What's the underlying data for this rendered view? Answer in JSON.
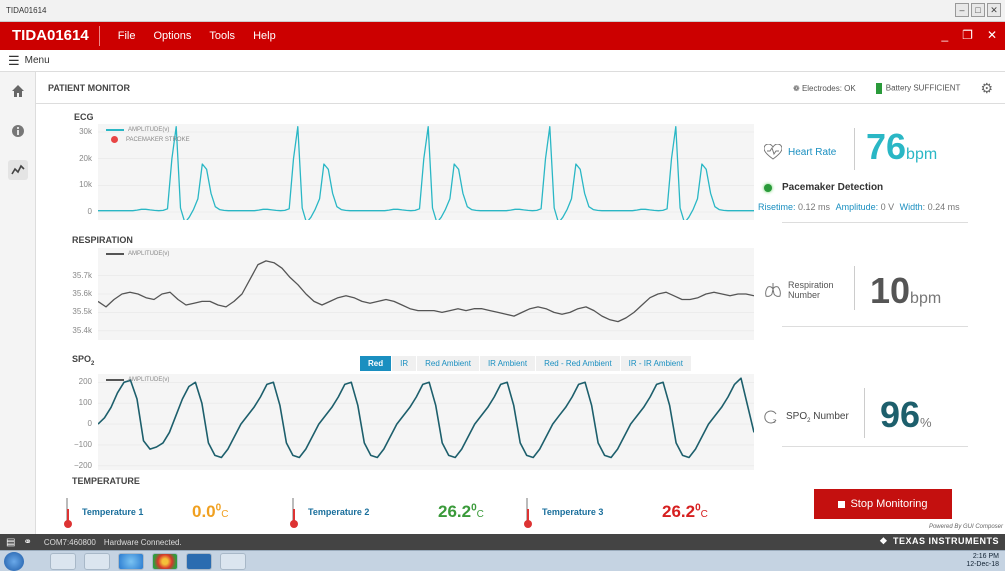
{
  "window": {
    "title": "TIDA01614",
    "min": "–",
    "max": "□",
    "close": "✕"
  },
  "menubar": {
    "app_name": "TIDA01614",
    "items": [
      "File",
      "Options",
      "Tools",
      "Help"
    ],
    "min": "_",
    "restore": "❐",
    "close": "✕"
  },
  "subbar": {
    "menu_label": "Menu"
  },
  "sidebar": {
    "icons": [
      "home-icon",
      "info-icon",
      "chart-icon"
    ]
  },
  "header": {
    "title": "PATIENT MONITOR",
    "electrodes": "Electrodes: OK",
    "battery": "Battery SUFFICIENT"
  },
  "ecg": {
    "title": "ECG",
    "legend": [
      "AMPLITUDE(v)",
      "PACEMAKER STROKE"
    ]
  },
  "respiration": {
    "title": "RESPIRATION",
    "legend": "AMPLITUDE(v)"
  },
  "spo2": {
    "title_main": "SPO",
    "title_sub": "2",
    "legend": "AMPLITUDE(v)",
    "tabs": [
      "Red",
      "IR",
      "Red Ambient",
      "IR Ambient",
      "Red - Red Ambient",
      "IR - IR Ambient"
    ],
    "active_tab": "Red"
  },
  "heart_rate": {
    "label": "Heart Rate",
    "value": "76",
    "unit": "bpm",
    "color": "#2ab7c5"
  },
  "pacemaker": {
    "label": "Pacemaker Detection",
    "risetime_label": "Risetime:",
    "risetime_value": "0.12 ms",
    "amplitude_label": "Amplitude:",
    "amplitude_value": "0 V",
    "width_label": "Width",
    "width_value": ": 0.24 ms"
  },
  "respiration_metric": {
    "label1": "Respiration",
    "label2": "Number",
    "value": "10",
    "unit": "bpm"
  },
  "spo2_metric": {
    "label_main": "SPO",
    "label_sub": "2",
    "label_rest": " Number",
    "value": "96",
    "unit": "%"
  },
  "temperature": {
    "title": "TEMPERATURE",
    "items": [
      {
        "label": "Temperature 1",
        "value": "0.0",
        "deg": "0",
        "unit": "C",
        "color": "#f0a020"
      },
      {
        "label": "Temperature 2",
        "value": "26.2",
        "deg": "0",
        "unit": "C",
        "color": "#3a9a3a"
      },
      {
        "label": "Temperature 3",
        "value": "26.2",
        "deg": "0",
        "unit": "C",
        "color": "#d62020"
      }
    ]
  },
  "stop_button": {
    "label": "Stop Monitoring"
  },
  "powered_by": "Powered By GUI Composer",
  "status": {
    "port": "COM7:460800",
    "connection": "Hardware Connected.",
    "brand": "TEXAS INSTRUMENTS"
  },
  "taskbar": {
    "time": "2:16 PM",
    "date": "12-Dec-18"
  },
  "chart_data": [
    {
      "type": "line",
      "title": "ECG",
      "ylim": [
        -3000,
        33000
      ],
      "y_ticks": [
        "30k",
        "20k",
        "10k",
        "0"
      ],
      "y_tick_values": [
        30000,
        20000,
        10000,
        0
      ],
      "series": [
        {
          "name": "AMPLITUDE(v)",
          "color": "#2ab7c5",
          "values": [
            500,
            500,
            500,
            500,
            500,
            500,
            500,
            500,
            500,
            700,
            1000,
            1000,
            800,
            600,
            500,
            600,
            1200,
            20000,
            32000,
            1500,
            -4000,
            -2000,
            1000,
            5000,
            18000,
            16000,
            7000,
            2000,
            900,
            600,
            500,
            500,
            500,
            500,
            500,
            500,
            500,
            700,
            1000,
            1000,
            800,
            600,
            500,
            600,
            1200,
            20000,
            32000,
            1500,
            -4000,
            -2000,
            1000,
            5000,
            18000,
            16000,
            7000,
            2000,
            900,
            600,
            500,
            500,
            500,
            500,
            500,
            500,
            500,
            500,
            500,
            700,
            1000,
            1000,
            800,
            600,
            500,
            600,
            1200,
            20000,
            32000,
            1500,
            -4000,
            -2000,
            1000,
            5000,
            18000,
            16000,
            7000,
            2000,
            900,
            600,
            500,
            500,
            500,
            500,
            500,
            500,
            500,
            700,
            1000,
            1000,
            800,
            600,
            500,
            600,
            1200,
            20000,
            32000,
            1500,
            -4000,
            -2000,
            1000,
            5000,
            18000,
            16000,
            7000,
            2000,
            900,
            600,
            500,
            500,
            500,
            500,
            500,
            500,
            500,
            500,
            700,
            1000,
            1000,
            800,
            600,
            500,
            600,
            1200,
            20000,
            32000,
            1500,
            -4000,
            -2000,
            1000,
            5000,
            18000,
            16000,
            7000,
            2000,
            900,
            600,
            500,
            500,
            500,
            500,
            500,
            500,
            500
          ]
        },
        {
          "name": "PACEMAKER STROKE",
          "color": "#e84545",
          "values": []
        }
      ]
    },
    {
      "type": "line",
      "title": "RESPIRATION",
      "ylim": [
        35350,
        35850
      ],
      "y_ticks": [
        "35.7k",
        "35.6k",
        "35.5k",
        "35.4k"
      ],
      "y_tick_values": [
        35700,
        35600,
        35500,
        35400
      ],
      "series": [
        {
          "name": "AMPLITUDE(v)",
          "color": "#555",
          "values": [
            35560,
            35530,
            35570,
            35600,
            35610,
            35600,
            35580,
            35570,
            35600,
            35610,
            35570,
            35540,
            35550,
            35560,
            35560,
            35540,
            35530,
            35560,
            35600,
            35680,
            35760,
            35780,
            35770,
            35740,
            35690,
            35650,
            35600,
            35560,
            35540,
            35560,
            35580,
            35590,
            35580,
            35560,
            35550,
            35560,
            35570,
            35560,
            35540,
            35520,
            35510,
            35510,
            35510,
            35500,
            35510,
            35520,
            35510,
            35520,
            35520,
            35510,
            35500,
            35490,
            35480,
            35500,
            35520,
            35530,
            35520,
            35500,
            35490,
            35500,
            35520,
            35530,
            35510,
            35480,
            35460,
            35450,
            35470,
            35500,
            35540,
            35580,
            35600,
            35610,
            35590,
            35570,
            35570,
            35580,
            35600,
            35610,
            35600,
            35590,
            35600,
            35600,
            35590
          ]
        }
      ]
    },
    {
      "type": "line",
      "title": "SPO2",
      "ylim": [
        -220,
        240
      ],
      "y_ticks": [
        "200",
        "100",
        "0",
        "−100",
        "−200"
      ],
      "y_tick_values": [
        200,
        100,
        0,
        -100,
        -200
      ],
      "series": [
        {
          "name": "AMPLITUDE(v)",
          "color": "#1d5f6c",
          "values": [
            0,
            30,
            80,
            150,
            200,
            210,
            120,
            -80,
            -120,
            -110,
            -90,
            -40,
            40,
            120,
            180,
            200,
            100,
            -90,
            -150,
            -160,
            -120,
            -60,
            0,
            40,
            80,
            130,
            190,
            200,
            90,
            -90,
            -150,
            -160,
            -120,
            -60,
            0,
            40,
            80,
            130,
            190,
            200,
            90,
            -90,
            -150,
            -160,
            -120,
            -60,
            0,
            40,
            80,
            130,
            190,
            200,
            90,
            -90,
            -150,
            -160,
            -120,
            -60,
            0,
            40,
            80,
            130,
            190,
            200,
            90,
            -90,
            -150,
            -160,
            -120,
            -60,
            0,
            40,
            80,
            130,
            190,
            200,
            90,
            -90,
            -150,
            -160,
            -120,
            -60,
            0,
            40,
            80,
            130,
            190,
            200,
            90,
            -90,
            -150,
            -160,
            -120,
            -60,
            0,
            40,
            80,
            130,
            190,
            220,
            90,
            -40
          ]
        }
      ]
    }
  ]
}
